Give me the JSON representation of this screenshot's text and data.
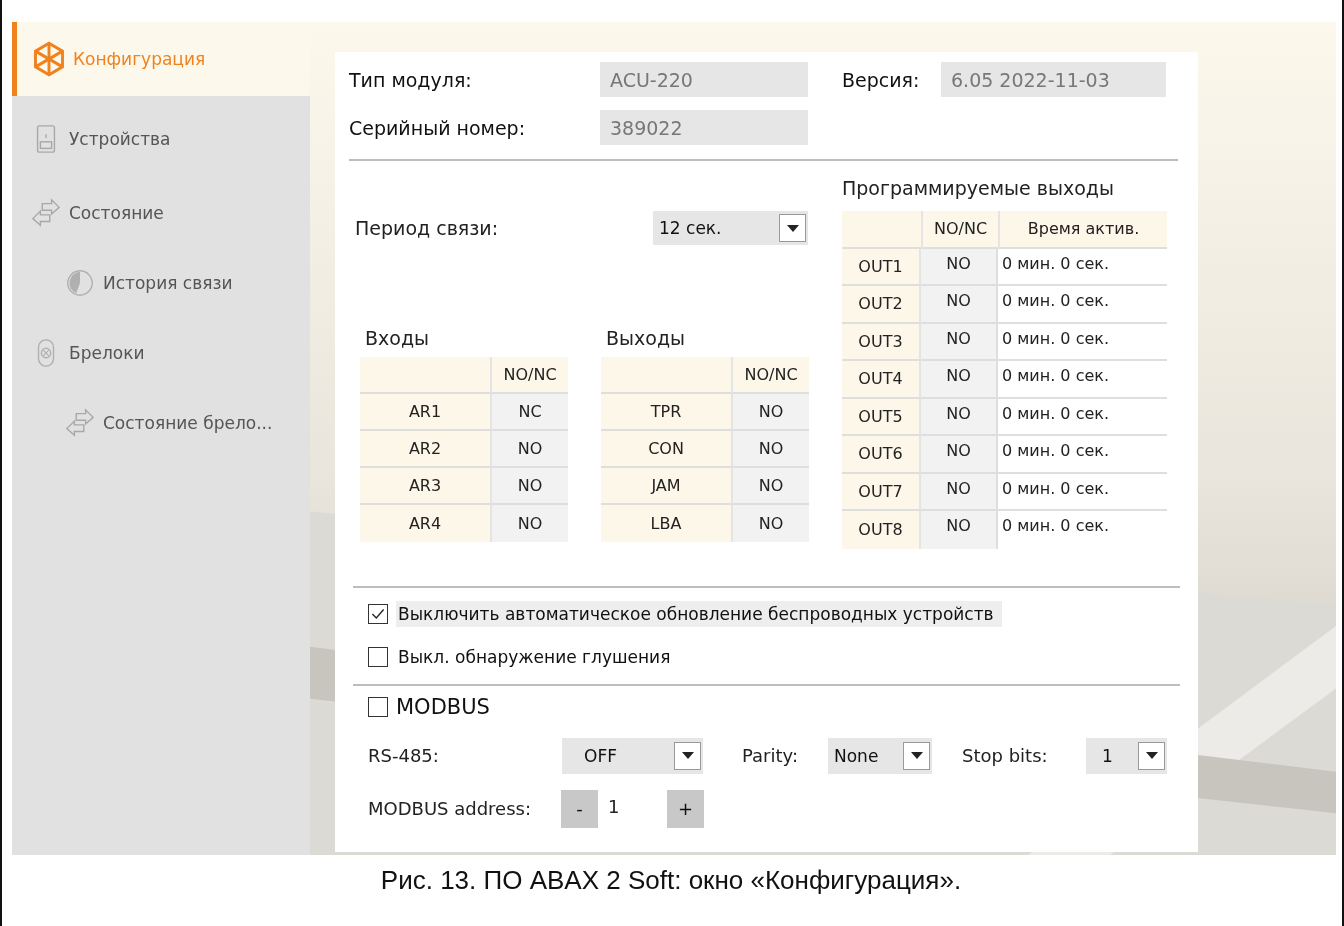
{
  "sidebar": {
    "items": [
      {
        "label": "Конфигурация",
        "kind": "config",
        "selected": true
      },
      {
        "label": "Устройства",
        "kind": "devices",
        "selected": false
      },
      {
        "label": "Состояние",
        "kind": "status",
        "selected": false,
        "children": [
          {
            "label": "История связи",
            "kind": "history",
            "selected": false
          }
        ]
      },
      {
        "label": "Брелоки",
        "kind": "keyfob",
        "selected": false,
        "children": [
          {
            "label": "Состояние брело...",
            "kind": "status",
            "selected": false
          }
        ]
      }
    ]
  },
  "module": {
    "type_label": "Тип модуля:",
    "type_value": "ACU-220",
    "version_label": "Версия:",
    "version_value": "6.05 2022-11-03",
    "serial_label": "Серийный номер:",
    "serial_value": "389022"
  },
  "period": {
    "label": "Период связи:",
    "value": "12 сек."
  },
  "inputs": {
    "title": "Входы",
    "column_2": "NO/NC",
    "rows": [
      {
        "name": "AR1",
        "mode": "NC"
      },
      {
        "name": "AR2",
        "mode": "NO"
      },
      {
        "name": "AR3",
        "mode": "NO"
      },
      {
        "name": "AR4",
        "mode": "NO"
      }
    ]
  },
  "outputs": {
    "title": "Выходы",
    "column_2": "NO/NC",
    "rows": [
      {
        "name": "TPR",
        "mode": "NO"
      },
      {
        "name": "CON",
        "mode": "NO"
      },
      {
        "name": "JAM",
        "mode": "NO"
      },
      {
        "name": "LBA",
        "mode": "NO"
      }
    ]
  },
  "programmable_outputs": {
    "title": "Программируемые выходы",
    "columns": [
      "NO/NC",
      "Время актив."
    ],
    "rows": [
      {
        "name": "OUT1",
        "mode": "NO",
        "time": "0 мин. 0 сек."
      },
      {
        "name": "OUT2",
        "mode": "NO",
        "time": "0 мин. 0 сек."
      },
      {
        "name": "OUT3",
        "mode": "NO",
        "time": "0 мин. 0 сек."
      },
      {
        "name": "OUT4",
        "mode": "NO",
        "time": "0 мин. 0 сек."
      },
      {
        "name": "OUT5",
        "mode": "NO",
        "time": "0 мин. 0 сек."
      },
      {
        "name": "OUT6",
        "mode": "NO",
        "time": "0 мин. 0 сек."
      },
      {
        "name": "OUT7",
        "mode": "NO",
        "time": "0 мин. 0 сек."
      },
      {
        "name": "OUT8",
        "mode": "NO",
        "time": "0 мин. 0 сек."
      }
    ]
  },
  "options": [
    {
      "label": "Выключить автоматическое обновление беспроводных устройств",
      "checked": true,
      "focused": true
    },
    {
      "label": "Выкл. обнаружение глушения",
      "checked": false,
      "focused": false
    }
  ],
  "modbus": {
    "label": "MODBUS",
    "checked": false,
    "rs485": {
      "label": "RS-485:",
      "value": "OFF"
    },
    "parity": {
      "label": "Parity:",
      "value": "None"
    },
    "stop_bits": {
      "label": "Stop bits:",
      "value": "1"
    },
    "address": {
      "label": "MODBUS address:",
      "minus": "-",
      "value": "1",
      "plus": "+"
    }
  },
  "caption": "Рис. 13. ПО ABAX 2 Soft: окно «Конфигурация»."
}
